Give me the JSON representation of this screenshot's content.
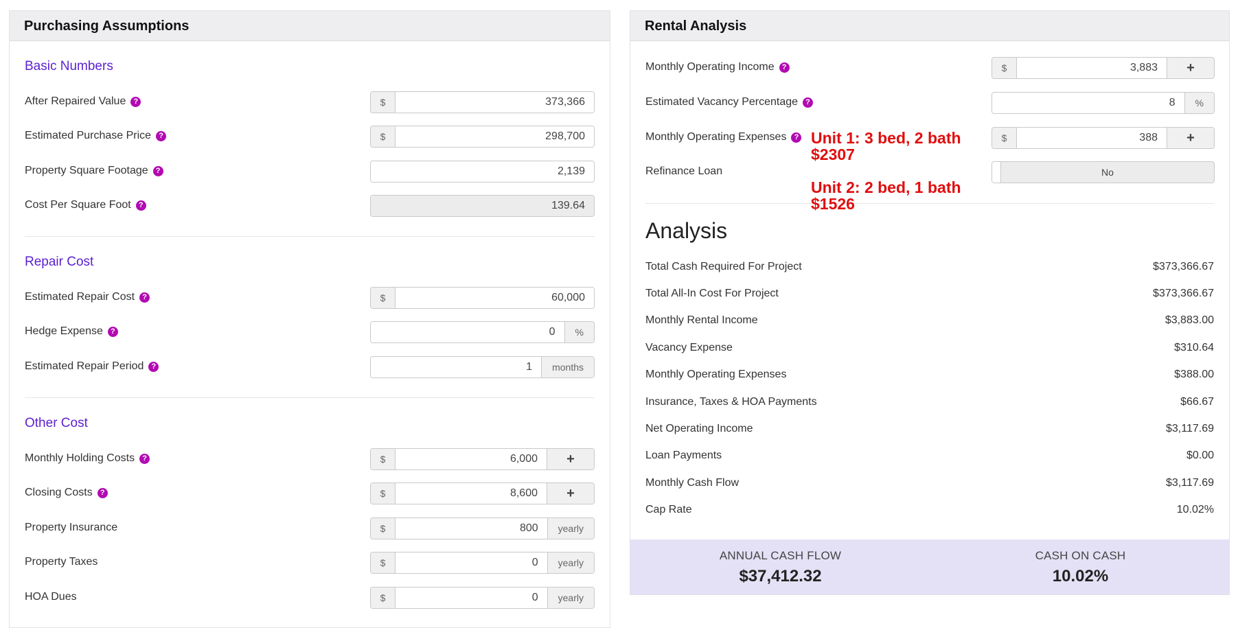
{
  "left": {
    "title": "Purchasing Assumptions",
    "sections": {
      "basic": "Basic Numbers",
      "repair": "Repair Cost",
      "other": "Other Cost"
    },
    "fields": {
      "arv": {
        "label": "After Repaired Value",
        "prefix": "$",
        "value": "373,366"
      },
      "purchase_price": {
        "label": "Estimated Purchase Price",
        "prefix": "$",
        "value": "298,700"
      },
      "sqft": {
        "label": "Property Square Footage",
        "value": "2,139"
      },
      "cost_per_sqft": {
        "label": "Cost Per Square Foot",
        "value": "139.64"
      },
      "repair_cost": {
        "label": "Estimated Repair Cost",
        "prefix": "$",
        "value": "60,000"
      },
      "hedge": {
        "label": "Hedge Expense",
        "value": "0",
        "suffix": "%"
      },
      "repair_period": {
        "label": "Estimated Repair Period",
        "value": "1",
        "suffix": "months"
      },
      "holding": {
        "label": "Monthly Holding Costs",
        "prefix": "$",
        "value": "6,000",
        "action": "+"
      },
      "closing": {
        "label": "Closing Costs",
        "prefix": "$",
        "value": "8,600",
        "action": "+"
      },
      "insurance": {
        "label": "Property Insurance",
        "prefix": "$",
        "value": "800",
        "suffix": "yearly"
      },
      "taxes": {
        "label": "Property Taxes",
        "prefix": "$",
        "value": "0",
        "suffix": "yearly"
      },
      "hoa": {
        "label": "HOA Dues",
        "prefix": "$",
        "value": "0",
        "suffix": "yearly"
      }
    }
  },
  "right": {
    "title": "Rental Analysis",
    "fields": {
      "income": {
        "label": "Monthly Operating Income",
        "prefix": "$",
        "value": "3,883",
        "action": "+"
      },
      "vacancy": {
        "label": "Estimated Vacancy Percentage",
        "value": "8",
        "suffix": "%"
      },
      "expenses": {
        "label": "Monthly Operating Expenses",
        "prefix": "$",
        "value": "388",
        "action": "+"
      },
      "refinance": {
        "label": "Refinance Loan",
        "value": "No"
      }
    },
    "analysis": {
      "title": "Analysis",
      "rows": [
        {
          "label": "Total Cash Required For Project",
          "value": "$373,366.67"
        },
        {
          "label": "Total All-In Cost For Project",
          "value": "$373,366.67"
        },
        {
          "label": "Monthly Rental Income",
          "value": "$3,883.00"
        },
        {
          "label": "Vacancy Expense",
          "value": "$310.64"
        },
        {
          "label": "Monthly Operating Expenses",
          "value": "$388.00"
        },
        {
          "label": "Insurance, Taxes & HOA Payments",
          "value": "$66.67"
        },
        {
          "label": "Net Operating Income",
          "value": "$3,117.69"
        },
        {
          "label": "Loan Payments",
          "value": "$0.00"
        },
        {
          "label": "Monthly Cash Flow",
          "value": "$3,117.69"
        },
        {
          "label": "Cap Rate",
          "value": "10.02%"
        }
      ]
    },
    "footer": {
      "annual_label": "ANNUAL CASH FLOW",
      "annual_value": "$37,412.32",
      "coc_label": "CASH ON CASH",
      "coc_value": "10.02%"
    }
  },
  "annotations": {
    "unit1_line1": "Unit 1: 3 bed, 2 bath",
    "unit1_line2": "$2307",
    "unit2_line1": "Unit 2: 2 bed, 1 bath",
    "unit2_line2": "$1526"
  },
  "help_glyph": "?",
  "colors": {
    "accent": "#5b1fcf",
    "help": "#b20ab2",
    "annotation": "#e10e0e",
    "footer_bg": "#e4e1f6"
  }
}
